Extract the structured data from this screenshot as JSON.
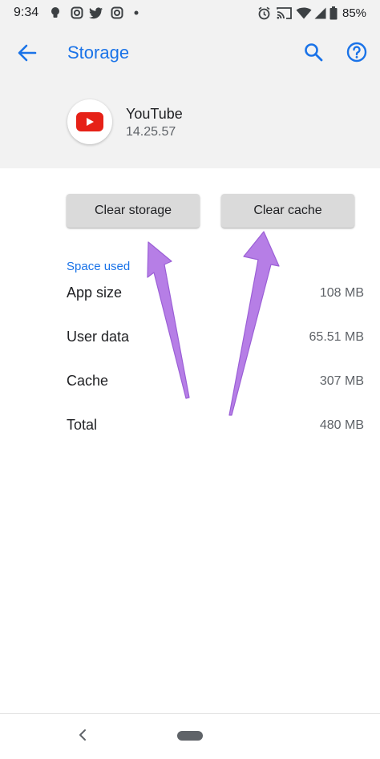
{
  "status_bar": {
    "time": "9:34",
    "battery_percent": "85%",
    "left_icons": [
      "lightbulb-icon",
      "instagram-icon",
      "twitter-icon",
      "instagram-icon",
      "dot-icon"
    ],
    "right_icons": [
      "alarm-icon",
      "cast-icon",
      "wifi-icon",
      "signal-icon",
      "battery-icon"
    ]
  },
  "app_bar": {
    "title": "Storage",
    "back_icon": "arrow-left-icon",
    "search_icon": "search-icon",
    "help_icon": "help-icon"
  },
  "app_info": {
    "name": "YouTube",
    "version": "14.25.57",
    "icon": "youtube-icon"
  },
  "actions": {
    "clear_storage_label": "Clear storage",
    "clear_cache_label": "Clear cache"
  },
  "space_used": {
    "section_title": "Space used",
    "rows": [
      {
        "label": "App size",
        "value": "108 MB"
      },
      {
        "label": "User data",
        "value": "65.51 MB"
      },
      {
        "label": "Cache",
        "value": "307 MB"
      },
      {
        "label": "Total",
        "value": "480 MB"
      }
    ]
  },
  "colors": {
    "accent": "#1a73e8",
    "header_bg": "#f2f2f2",
    "button_bg": "#dadada",
    "arrow": "#b67ee6",
    "youtube_red": "#e62117"
  },
  "nav_bar": {
    "back_icon": "chevron-left-icon",
    "home_icon": "home-pill-icon"
  }
}
